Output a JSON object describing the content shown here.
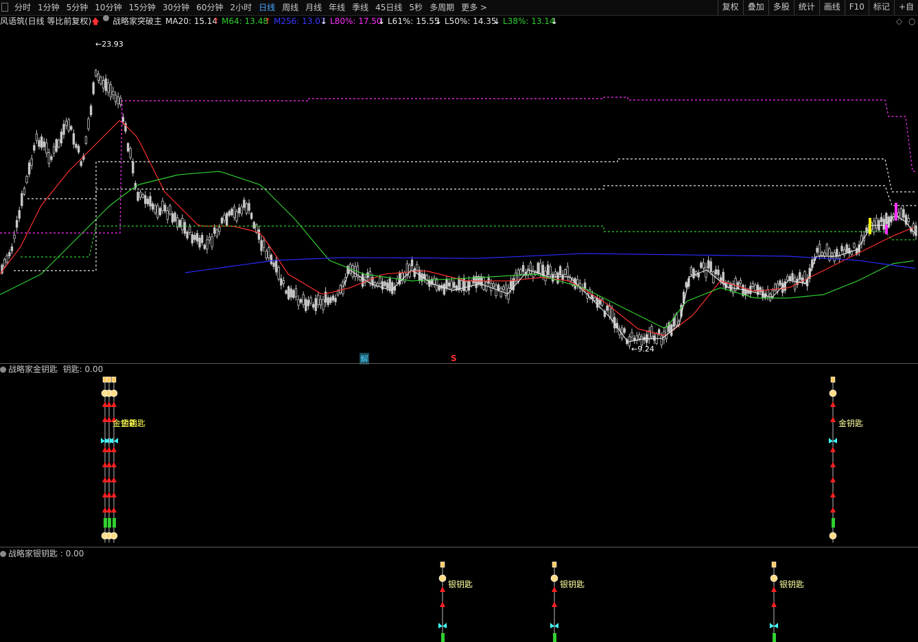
{
  "toolbar": {
    "tabs": [
      "分时",
      "1分钟",
      "5分钟",
      "10分钟",
      "15分钟",
      "30分钟",
      "60分钟",
      "2小时",
      "日线",
      "周线",
      "月线",
      "年线",
      "季线",
      "45日线",
      "5秒",
      "多周期",
      "更多 >"
    ],
    "active_tab": "日线",
    "right_tools": [
      "复权",
      "叠加",
      "多股",
      "统计",
      "画线",
      "F10",
      "标记",
      "+自"
    ]
  },
  "main_info": {
    "title": "风语筑(日线 等比前复权)",
    "indicator": "战略家突破主",
    "ma20": "MA20: 15.14",
    "m64": "M64: 13.48",
    "m256": "M256: 13.07",
    "l80": "L80%: 17.50",
    "l61": "L61%: 15.55",
    "l50": "L50%: 14.35",
    "l38": "L38%: 13.14",
    "high_label": "23.93",
    "low_label": "9.24",
    "marker_jie": "解",
    "marker_s": "S"
  },
  "panel_gold": {
    "title": "战略家金钥匙",
    "value": "钥匙: 0.00",
    "label": "金钥匙",
    "label_overlap": "金钥匙"
  },
  "panel_silver": {
    "title": "战略家银钥匙",
    "value": ": 0.00",
    "label": "银钥匙"
  },
  "colors": {
    "ma20": "#ff3030",
    "m64": "#30d030",
    "m256": "#2a2aff",
    "l80": "#ff30ff",
    "l61": "#e8e8e8",
    "l50": "#e8e8e8",
    "l38": "#30d030",
    "candle": "#c8c8c8",
    "active_tab": "#4aa8ff",
    "label_yellow": "#ffff80"
  }
}
